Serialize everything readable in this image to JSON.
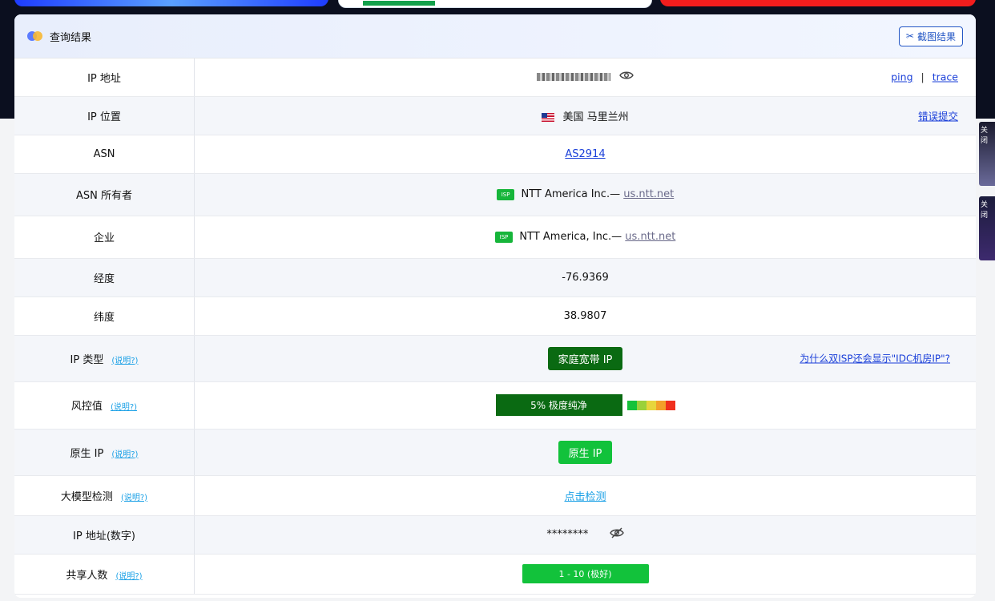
{
  "header": {
    "title": "查询结果",
    "screenshot_button": "截图结果"
  },
  "side_ads": [
    {
      "close": "关闭"
    },
    {
      "close": "关闭"
    }
  ],
  "help_label": "(说明?)",
  "rows": {
    "ip": {
      "label": "IP 地址",
      "ping": "ping",
      "sep": "|",
      "trace": "trace"
    },
    "location": {
      "label": "IP 位置",
      "value": "美国 马里兰州",
      "report": "错误提交"
    },
    "asn": {
      "label": "ASN",
      "value": "AS2914"
    },
    "asn_owner": {
      "label": "ASN 所有者",
      "badge": "ISP",
      "name": "NTT America Inc.—",
      "domain": "us.ntt.net"
    },
    "company": {
      "label": "企业",
      "badge": "ISP",
      "name": "NTT America, Inc.—",
      "domain": "us.ntt.net"
    },
    "longitude": {
      "label": "经度",
      "value": "-76.9369"
    },
    "latitude": {
      "label": "纬度",
      "value": "38.9807"
    },
    "ip_type": {
      "label": "IP 类型",
      "value": "家庭宽带 IP",
      "note": "为什么双ISP还会显示\"IDC机房IP\"?"
    },
    "risk": {
      "label": "风控值",
      "value": "5%   极度纯净",
      "percent": 5
    },
    "native": {
      "label": "原生 IP",
      "value": "原生 IP"
    },
    "llm": {
      "label": "大模型检测",
      "value": "点击检测"
    },
    "ip_numeric": {
      "label": "IP 地址(数字)",
      "value": "********"
    },
    "shared": {
      "label": "共享人数",
      "value": "1 - 10 (极好)"
    }
  }
}
